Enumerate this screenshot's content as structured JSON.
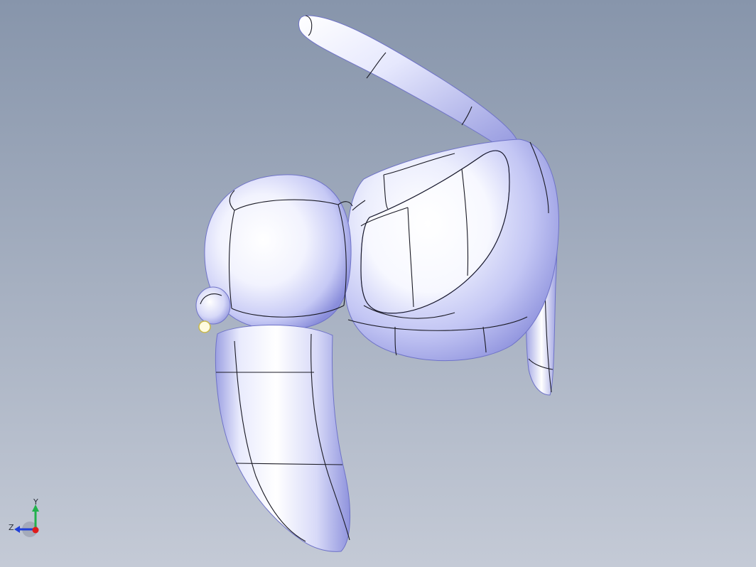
{
  "viewport": {
    "background_top": "#8795ab",
    "background_bottom": "#c4cad6",
    "shading": {
      "highlight": "#ffffff",
      "mid": "#c9ccf6",
      "shadow": "#7e82d6",
      "edge": "#1a1a24"
    }
  },
  "triad": {
    "y_label": "Y",
    "z_label": "Z",
    "y_color": "#22b14c",
    "z_color": "#1f3fd8",
    "x_color": "#e01b1b"
  }
}
